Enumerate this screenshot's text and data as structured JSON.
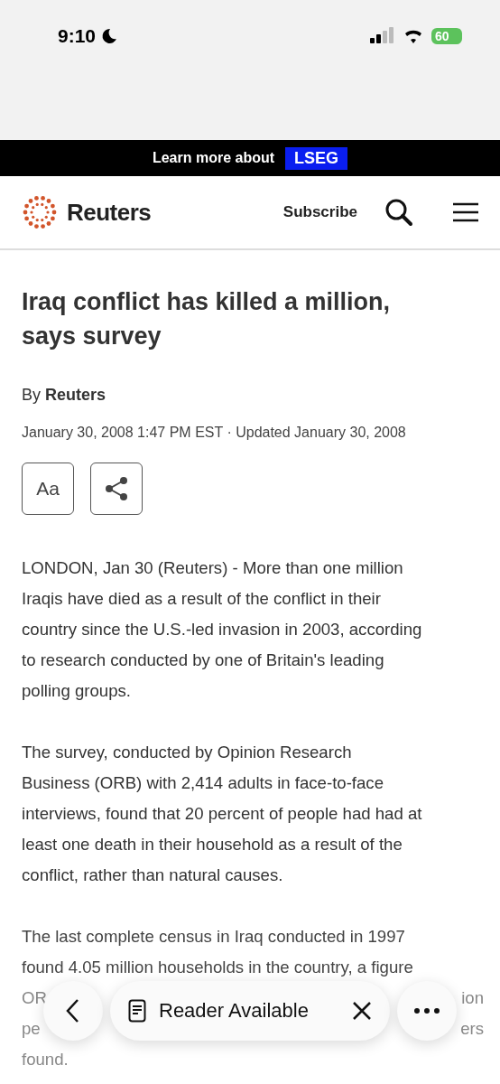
{
  "status_bar": {
    "time": "9:10",
    "battery": "60"
  },
  "banner": {
    "text": "Learn more about",
    "brand": "LSEG"
  },
  "header": {
    "logo": "Reuters",
    "subscribe": "Subscribe"
  },
  "article": {
    "headline": "Iraq conflict has killed a million, says survey",
    "byline_prefix": "By",
    "byline_author": "Reuters",
    "dateline": "January 30, 2008 1:47 PM EST · Updated January 30, 2008",
    "font_button": "Aa",
    "paragraphs": [
      "LONDON, Jan 30 (Reuters) - More than one million Iraqis have died as a result of the conflict in their country since the U.S.-led invasion in 2003, according to research conducted by one of Britain's leading polling groups.",
      "The survey, conducted by Opinion Research Business (ORB) with 2,414 adults in face-to-face interviews, found that 20 percent of people had had at least one death in their household as a result of the conflict, rather than natural causes."
    ],
    "last_paragraph_lines": [
      {
        "left": "The last complete census in Iraq conducted in 1997"
      },
      {
        "left": "found 4.05 million households in the country, a figure"
      },
      {
        "left": "OR",
        "right": "ion"
      },
      {
        "left": "pe",
        "right": "ers"
      },
      {
        "left": "found."
      }
    ]
  },
  "toolbar": {
    "reader": "Reader Available"
  }
}
